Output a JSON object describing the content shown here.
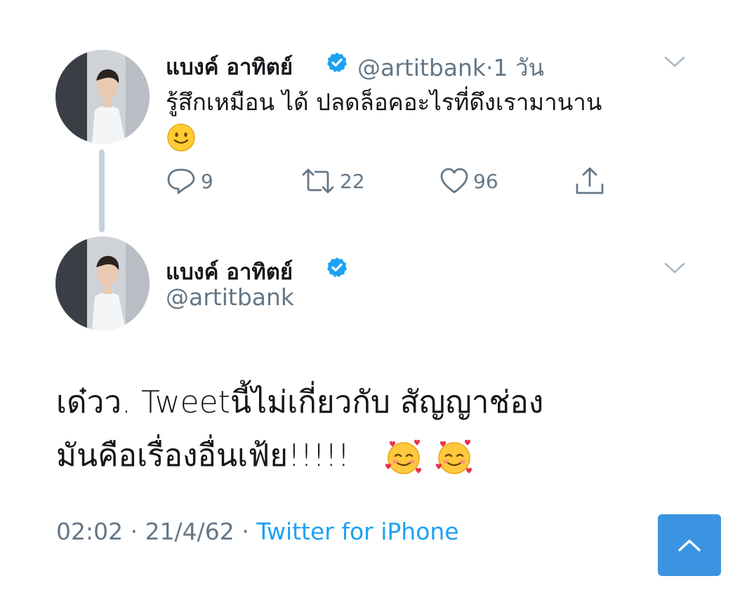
{
  "tweet1": {
    "display_name": "แบงค์ อาทิตย์",
    "handle": "@artitbank",
    "separator": "·",
    "time": "1 วัน",
    "text": "รู้สึกเหมือน ได้ ปลดล็อคอะไรที่ดึงเรามานาน",
    "emoji": "slightly-smiling-face",
    "actions": {
      "reply_count": "9",
      "retweet_count": "22",
      "like_count": "96"
    }
  },
  "tweet2": {
    "display_name": "แบงค์ อาทิตย์",
    "handle": "@artitbank",
    "text_line1": "เด๋วว. Tweetนี้ไม่เกี่ยวกับ สัญญาช่อง",
    "text_line2": "มันคือเรื่องอื่นเฟ้ย!!!!!",
    "emojis": [
      "smiling-face-with-hearts",
      "smiling-face-with-hearts"
    ],
    "timestamp": "02:02 · 21/4/62 ·",
    "source": "Twitter for iPhone"
  },
  "colors": {
    "accent": "#1da1f2",
    "muted": "#657786",
    "scroll_button": "#3b94e1",
    "thread_line": "#c6d0d8"
  },
  "icons": {
    "verified": "verified-badge-icon",
    "chevron": "chevron-down-icon",
    "reply": "reply-icon",
    "retweet": "retweet-icon",
    "like": "heart-icon",
    "share": "share-icon",
    "scroll_top": "chevron-up-icon"
  }
}
